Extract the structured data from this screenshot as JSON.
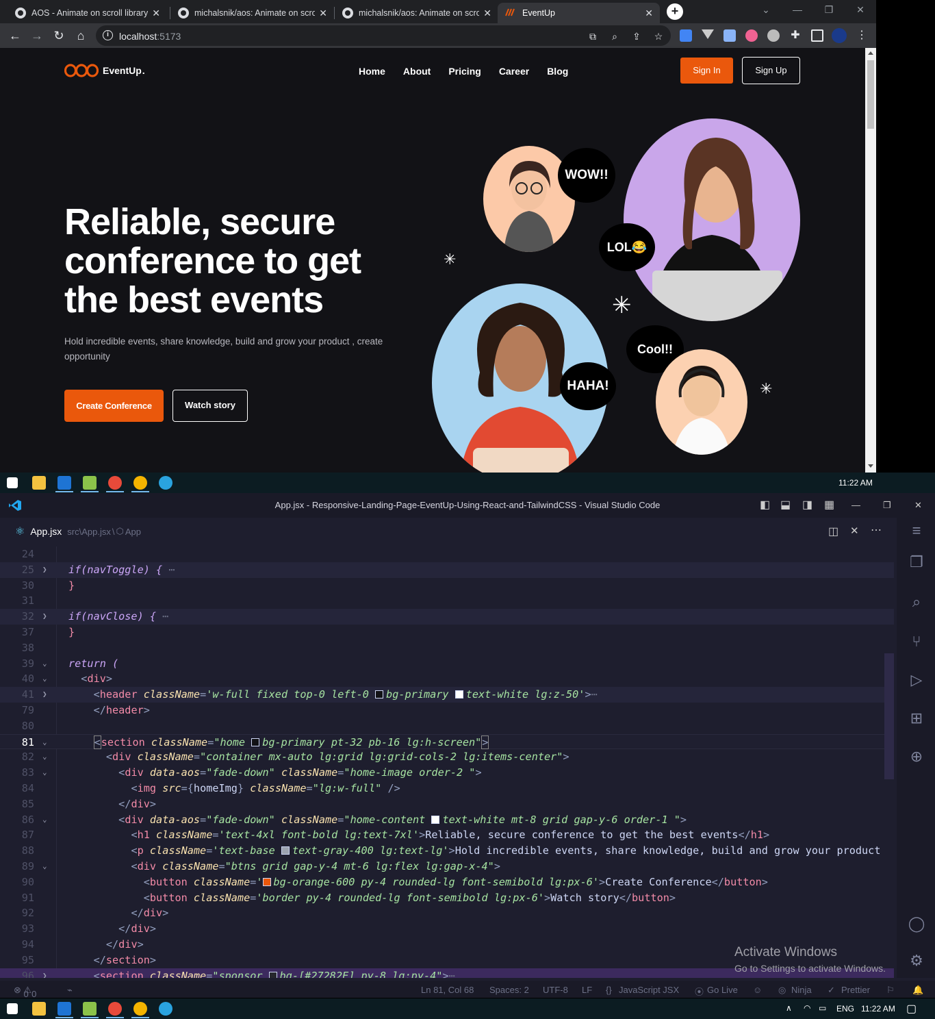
{
  "browser": {
    "tabs": [
      {
        "title": "AOS - Animate on scroll library"
      },
      {
        "title": "michalsnik/aos: Animate on scroll"
      },
      {
        "title": "michalsnik/aos: Animate on scroll"
      },
      {
        "title": "EventUp"
      }
    ],
    "url_host": "localhost",
    "url_port": ":5173"
  },
  "site": {
    "logo_text": "EventUp",
    "nav": [
      "Home",
      "About",
      "Pricing",
      "Career",
      "Blog"
    ],
    "signin_label": "Sign In",
    "signup_label": "Sign Up",
    "hero_title": "Reliable, secure conference to get the best events",
    "hero_subtitle": "Hold incredible events, share knowledge, build and grow your product , create opportunity",
    "create_label": "Create Conference",
    "watch_label": "Watch story",
    "bubbles": [
      "WOW!!",
      "LOL😂",
      "HAHA!",
      "Cool!!"
    ],
    "accent": "#ea580c"
  },
  "taskbar": {
    "time": "11:22 AM",
    "lang": "ENG"
  },
  "vscode": {
    "title": "App.jsx - Responsive-Landing-Page-EventUp-Using-React-and-TailwindCSS - Visual Studio Code",
    "tab_label": "App.jsx",
    "breadcrumb_path": "src\\App.jsx",
    "breadcrumb_symbol": "App",
    "activate_title": "Activate Windows",
    "activate_sub": "Go to Settings to activate Windows.",
    "status": {
      "errors": "0",
      "warnings": "0",
      "position": "Ln 81, Col 68",
      "spaces": "Spaces: 2",
      "encoding": "UTF-8",
      "eol": "LF",
      "language": "JavaScript JSX",
      "golive": "Go Live",
      "ninja": "Ninja",
      "prettier": "Prettier"
    },
    "line_numbers": [
      "24",
      "25",
      "30",
      "31",
      "32",
      "37",
      "38",
      "39",
      "40",
      "41",
      "79",
      "80",
      "81",
      "82",
      "83",
      "84",
      "85",
      "86",
      "87",
      "88",
      "89",
      "90",
      "91",
      "92",
      "93",
      "94",
      "95",
      "96"
    ],
    "code_text": {
      "l25": "if(navToggle) {",
      "l32": "if(navClose) {",
      "l39": "return (",
      "l41_class": "'w-full fixed top-0 left-0 ",
      "l81_class": "\"home ",
      "l88_text": "Hold incredible events, share knowledge, build and grow your product",
      "l87_text": "Reliable, secure conference to get the best events",
      "l90_text": "Create Conference",
      "l91_text": "Watch story"
    }
  }
}
